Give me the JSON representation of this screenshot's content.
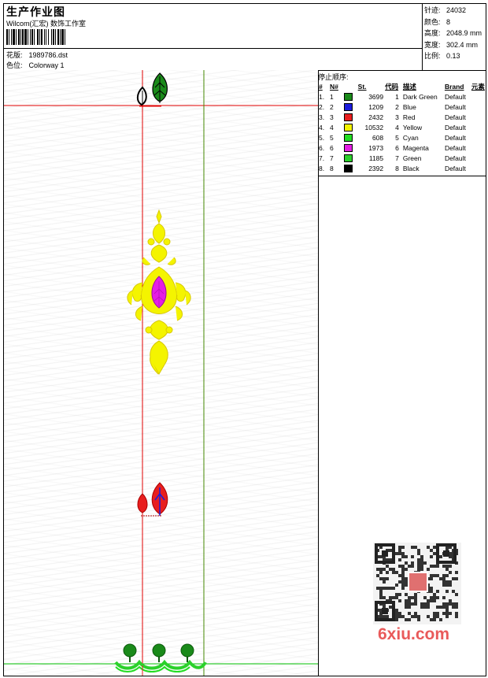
{
  "header": {
    "title": "生产作业图",
    "subtitle": "Wilcom(汇宏) 数饰工作室",
    "pattern_label": "花版:",
    "pattern_value": "1989786.dst",
    "colorway_label": "色位:",
    "colorway_value": "Colorway 1"
  },
  "stats": {
    "stitches_label": "针迹:",
    "stitches_value": "24032",
    "colors_label": "颜色:",
    "colors_value": "8",
    "height_label": "高度:",
    "height_value": "2048.9 mm",
    "width_label": "宽度:",
    "width_value": "302.4 mm",
    "scale_label": "比例:",
    "scale_value": "0.13"
  },
  "color_table": {
    "title": "停止顺序:",
    "headers": [
      "#",
      "N#",
      "St.",
      "代码",
      "描述",
      "Brand",
      "元素"
    ],
    "rows": [
      {
        "idx": "1.",
        "n": "1",
        "color": "#1a8a1a",
        "st": "3699",
        "code": "1",
        "desc": "Dark Green",
        "brand": "Default"
      },
      {
        "idx": "2.",
        "n": "2",
        "color": "#1c1cdc",
        "st": "1209",
        "code": "2",
        "desc": "Blue",
        "brand": "Default"
      },
      {
        "idx": "3.",
        "n": "3",
        "color": "#e81e1e",
        "st": "2432",
        "code": "3",
        "desc": "Red",
        "brand": "Default"
      },
      {
        "idx": "4.",
        "n": "4",
        "color": "#f4f400",
        "st": "10532",
        "code": "4",
        "desc": "Yellow",
        "brand": "Default"
      },
      {
        "idx": "5.",
        "n": "5",
        "color": "#22dd22",
        "st": "608",
        "code": "5",
        "desc": "Cyan",
        "brand": "Default"
      },
      {
        "idx": "6.",
        "n": "6",
        "color": "#e51ee5",
        "st": "1973",
        "code": "6",
        "desc": "Magenta",
        "brand": "Default"
      },
      {
        "idx": "7.",
        "n": "7",
        "color": "#2bd12b",
        "st": "1185",
        "code": "7",
        "desc": "Green",
        "brand": "Default"
      },
      {
        "idx": "8.",
        "n": "8",
        "color": "#000000",
        "st": "2392",
        "code": "8",
        "desc": "Black",
        "brand": "Default"
      }
    ]
  },
  "watermark": "6xiu.com",
  "colors": {
    "guide_red": "#e00000",
    "guide_green": "#00c000",
    "yellow": "#f4f400",
    "magenta": "#e51ee5",
    "red": "#e81e1e",
    "green": "#1a8a1a"
  }
}
